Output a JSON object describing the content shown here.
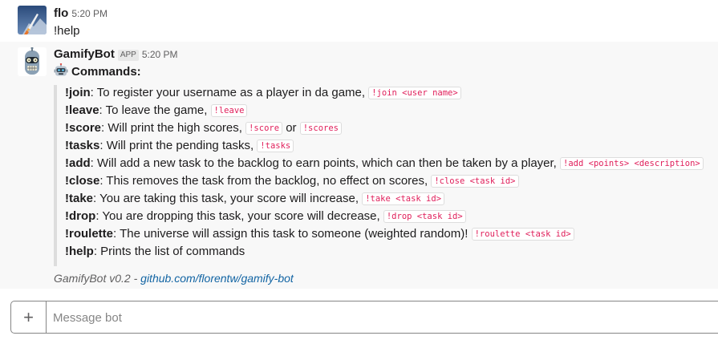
{
  "messages": [
    {
      "user": "flo",
      "time": "5:20 PM",
      "text": "!help"
    },
    {
      "user": "GamifyBot",
      "badge": "APP",
      "time": "5:20 PM",
      "title": "Commands:",
      "commands": [
        {
          "name": "!join",
          "desc": ": To register your username as a player in da game, ",
          "codes": [
            "!join <user name>"
          ]
        },
        {
          "name": "!leave",
          "desc": ": To leave the game, ",
          "codes": [
            "!leave"
          ]
        },
        {
          "name": "!score",
          "desc": ": Will print the high scores, ",
          "codes": [
            "!score",
            "!scores"
          ],
          "joiner": " or "
        },
        {
          "name": "!tasks",
          "desc": ": Will print the pending tasks, ",
          "codes": [
            "!tasks"
          ]
        },
        {
          "name": "!add",
          "desc": ": Will add a new task to the backlog to earn points, which can then be taken by a player, ",
          "codes": [
            "!add <points> <description>"
          ]
        },
        {
          "name": "!close",
          "desc": ": This removes the task from the backlog, no effect on scores, ",
          "codes": [
            "!close <task id>"
          ]
        },
        {
          "name": "!take",
          "desc": ": You are taking this task, your score will increase, ",
          "codes": [
            "!take <task id>"
          ]
        },
        {
          "name": "!drop",
          "desc": ": You are dropping this task, your score will decrease, ",
          "codes": [
            "!drop <task id>"
          ]
        },
        {
          "name": "!roulette",
          "desc": ": The universe will assign this task to someone (weighted random)! ",
          "codes": [
            "!roulette <task id>"
          ]
        },
        {
          "name": "!help",
          "desc": ": Prints the list of commands",
          "codes": []
        }
      ],
      "footer_text": "GamifyBot v0.2 - ",
      "footer_link": "github.com/florentw/gamify-bot"
    }
  ],
  "composer": {
    "plus": "+",
    "placeholder": "Message bot"
  },
  "colors": {
    "code_text": "#e01e5a",
    "link": "#1264a3",
    "attachment_bar": "#dddddd"
  },
  "icons": {
    "user_avatar": "rocket-launch-avatar-icon",
    "bot_avatar": "bender-robot-avatar-icon",
    "title_emoji": "robot-face-icon"
  }
}
